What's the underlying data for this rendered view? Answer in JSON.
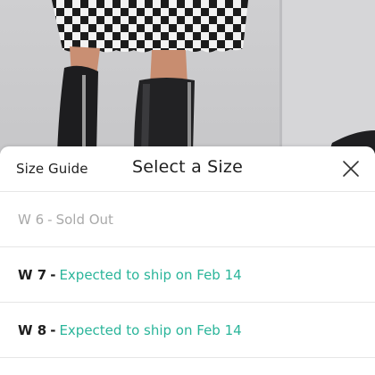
{
  "sheet": {
    "size_guide_label": "Size Guide",
    "title": "Select a Size",
    "close_icon": "close-icon"
  },
  "sizes": [
    {
      "size": "W 6",
      "separator": "-",
      "status": "Sold Out",
      "available": false
    },
    {
      "size": "W 7",
      "separator": "-",
      "status": "Expected to ship on Feb 14",
      "available": true
    },
    {
      "size": "W 8",
      "separator": "-",
      "status": "Expected to ship on Feb 14",
      "available": true
    }
  ],
  "colors": {
    "accent_status": "#2ab59a",
    "sold_out": "#a9a9a9",
    "text": "#1f1f1f"
  }
}
